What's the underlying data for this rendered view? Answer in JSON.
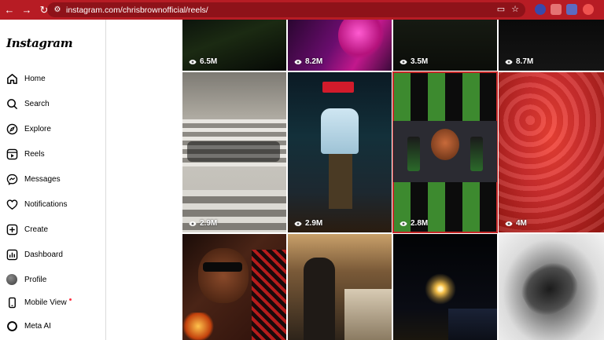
{
  "browser": {
    "url": "instagram.com/chrisbrownofficial/reels/"
  },
  "sidebar": {
    "logo": "Instagram",
    "items": [
      {
        "label": "Home"
      },
      {
        "label": "Search"
      },
      {
        "label": "Explore"
      },
      {
        "label": "Reels"
      },
      {
        "label": "Messages"
      },
      {
        "label": "Notifications"
      },
      {
        "label": "Create"
      },
      {
        "label": "Dashboard"
      },
      {
        "label": "Profile"
      },
      {
        "label": "Mobile View"
      },
      {
        "label": "Meta AI"
      }
    ]
  },
  "reels": [
    {
      "views": "6.5M"
    },
    {
      "views": "8.2M"
    },
    {
      "views": "3.5M"
    },
    {
      "views": "8.7M"
    },
    {
      "views": "2.9M"
    },
    {
      "views": "2.9M"
    },
    {
      "views": "2.8M"
    },
    {
      "views": "4M"
    },
    {
      "views": ""
    },
    {
      "views": ""
    },
    {
      "views": ""
    },
    {
      "views": ""
    }
  ],
  "colors": {
    "chrome": "#b71c24",
    "selected_outline": "#c62828"
  }
}
